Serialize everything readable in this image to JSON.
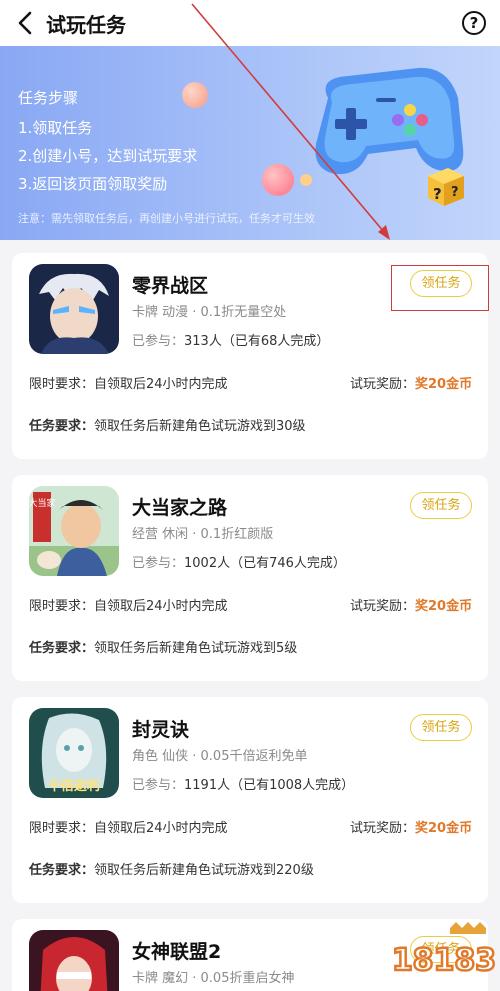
{
  "nav": {
    "title": "试玩任务",
    "help": "?"
  },
  "banner": {
    "heading": "任务步骤",
    "steps": [
      "1.领取任务",
      "2.创建小号，达到试玩要求",
      "3.返回该页面领取奖励"
    ],
    "note": "注意：需先领取任务后，再创建小号进行试玩，任务才可生效"
  },
  "labels": {
    "joined_prefix": "已参与：",
    "time_label": "限时要求：",
    "reward_label": "试玩奖励：",
    "task_label": "任务要求："
  },
  "games": [
    {
      "name": "零界战区",
      "tags": "卡牌 动漫 · 0.1折无量空处",
      "joined": "313人（已有68人完成）",
      "button": "领任务",
      "time_req": "自领取后24小时内完成",
      "reward": "奖20金币",
      "task_req": "领取任务后新建角色试玩游戏到30级"
    },
    {
      "name": "大当家之路",
      "tags": "经营 休闲 · 0.1折红颜版",
      "joined": "1002人（已有746人完成）",
      "button": "领任务",
      "time_req": "自领取后24小时内完成",
      "reward": "奖20金币",
      "task_req": "领取任务后新建角色试玩游戏到5级",
      "icon_text": "大当家"
    },
    {
      "name": "封灵诀",
      "tags": "角色 仙侠 · 0.05千倍返利免单",
      "joined": "1191人（已有1008人完成）",
      "button": "领任务",
      "time_req": "自领取后24小时内完成",
      "reward": "奖20金币",
      "task_req": "领取任务后新建角色试玩游戏到220级",
      "icon_text": "千倍返利"
    },
    {
      "name": "女神联盟2",
      "tags": "卡牌 魔幻 · 0.05折重启女神",
      "button": "领任务"
    }
  ],
  "watermark": "18183",
  "colors": {
    "accent": "#d9a514",
    "reward": "#e0792a",
    "highlight_box": "#d23b3b",
    "banner": "#89a8f4"
  }
}
